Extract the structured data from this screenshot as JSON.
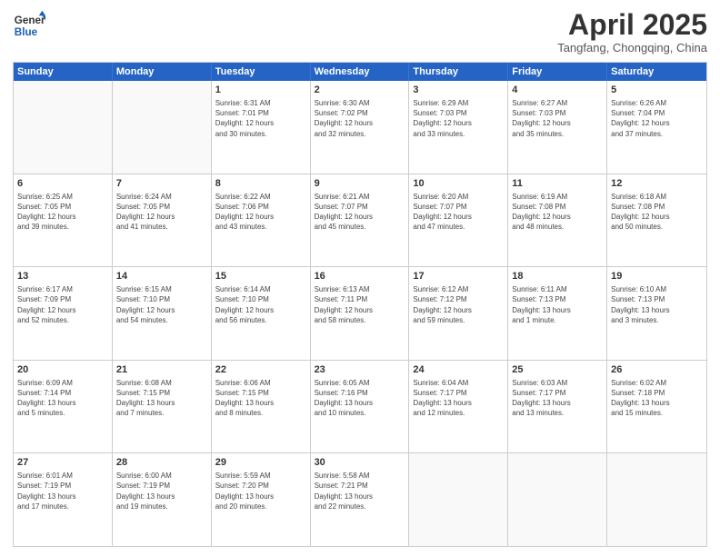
{
  "header": {
    "logo_line1": "General",
    "logo_line2": "Blue",
    "month": "April 2025",
    "location": "Tangfang, Chongqing, China"
  },
  "weekdays": [
    "Sunday",
    "Monday",
    "Tuesday",
    "Wednesday",
    "Thursday",
    "Friday",
    "Saturday"
  ],
  "rows": [
    [
      {
        "day": "",
        "info": ""
      },
      {
        "day": "",
        "info": ""
      },
      {
        "day": "1",
        "info": "Sunrise: 6:31 AM\nSunset: 7:01 PM\nDaylight: 12 hours\nand 30 minutes."
      },
      {
        "day": "2",
        "info": "Sunrise: 6:30 AM\nSunset: 7:02 PM\nDaylight: 12 hours\nand 32 minutes."
      },
      {
        "day": "3",
        "info": "Sunrise: 6:29 AM\nSunset: 7:03 PM\nDaylight: 12 hours\nand 33 minutes."
      },
      {
        "day": "4",
        "info": "Sunrise: 6:27 AM\nSunset: 7:03 PM\nDaylight: 12 hours\nand 35 minutes."
      },
      {
        "day": "5",
        "info": "Sunrise: 6:26 AM\nSunset: 7:04 PM\nDaylight: 12 hours\nand 37 minutes."
      }
    ],
    [
      {
        "day": "6",
        "info": "Sunrise: 6:25 AM\nSunset: 7:05 PM\nDaylight: 12 hours\nand 39 minutes."
      },
      {
        "day": "7",
        "info": "Sunrise: 6:24 AM\nSunset: 7:05 PM\nDaylight: 12 hours\nand 41 minutes."
      },
      {
        "day": "8",
        "info": "Sunrise: 6:22 AM\nSunset: 7:06 PM\nDaylight: 12 hours\nand 43 minutes."
      },
      {
        "day": "9",
        "info": "Sunrise: 6:21 AM\nSunset: 7:07 PM\nDaylight: 12 hours\nand 45 minutes."
      },
      {
        "day": "10",
        "info": "Sunrise: 6:20 AM\nSunset: 7:07 PM\nDaylight: 12 hours\nand 47 minutes."
      },
      {
        "day": "11",
        "info": "Sunrise: 6:19 AM\nSunset: 7:08 PM\nDaylight: 12 hours\nand 48 minutes."
      },
      {
        "day": "12",
        "info": "Sunrise: 6:18 AM\nSunset: 7:08 PM\nDaylight: 12 hours\nand 50 minutes."
      }
    ],
    [
      {
        "day": "13",
        "info": "Sunrise: 6:17 AM\nSunset: 7:09 PM\nDaylight: 12 hours\nand 52 minutes."
      },
      {
        "day": "14",
        "info": "Sunrise: 6:15 AM\nSunset: 7:10 PM\nDaylight: 12 hours\nand 54 minutes."
      },
      {
        "day": "15",
        "info": "Sunrise: 6:14 AM\nSunset: 7:10 PM\nDaylight: 12 hours\nand 56 minutes."
      },
      {
        "day": "16",
        "info": "Sunrise: 6:13 AM\nSunset: 7:11 PM\nDaylight: 12 hours\nand 58 minutes."
      },
      {
        "day": "17",
        "info": "Sunrise: 6:12 AM\nSunset: 7:12 PM\nDaylight: 12 hours\nand 59 minutes."
      },
      {
        "day": "18",
        "info": "Sunrise: 6:11 AM\nSunset: 7:13 PM\nDaylight: 13 hours\nand 1 minute."
      },
      {
        "day": "19",
        "info": "Sunrise: 6:10 AM\nSunset: 7:13 PM\nDaylight: 13 hours\nand 3 minutes."
      }
    ],
    [
      {
        "day": "20",
        "info": "Sunrise: 6:09 AM\nSunset: 7:14 PM\nDaylight: 13 hours\nand 5 minutes."
      },
      {
        "day": "21",
        "info": "Sunrise: 6:08 AM\nSunset: 7:15 PM\nDaylight: 13 hours\nand 7 minutes."
      },
      {
        "day": "22",
        "info": "Sunrise: 6:06 AM\nSunset: 7:15 PM\nDaylight: 13 hours\nand 8 minutes."
      },
      {
        "day": "23",
        "info": "Sunrise: 6:05 AM\nSunset: 7:16 PM\nDaylight: 13 hours\nand 10 minutes."
      },
      {
        "day": "24",
        "info": "Sunrise: 6:04 AM\nSunset: 7:17 PM\nDaylight: 13 hours\nand 12 minutes."
      },
      {
        "day": "25",
        "info": "Sunrise: 6:03 AM\nSunset: 7:17 PM\nDaylight: 13 hours\nand 13 minutes."
      },
      {
        "day": "26",
        "info": "Sunrise: 6:02 AM\nSunset: 7:18 PM\nDaylight: 13 hours\nand 15 minutes."
      }
    ],
    [
      {
        "day": "27",
        "info": "Sunrise: 6:01 AM\nSunset: 7:19 PM\nDaylight: 13 hours\nand 17 minutes."
      },
      {
        "day": "28",
        "info": "Sunrise: 6:00 AM\nSunset: 7:19 PM\nDaylight: 13 hours\nand 19 minutes."
      },
      {
        "day": "29",
        "info": "Sunrise: 5:59 AM\nSunset: 7:20 PM\nDaylight: 13 hours\nand 20 minutes."
      },
      {
        "day": "30",
        "info": "Sunrise: 5:58 AM\nSunset: 7:21 PM\nDaylight: 13 hours\nand 22 minutes."
      },
      {
        "day": "",
        "info": ""
      },
      {
        "day": "",
        "info": ""
      },
      {
        "day": "",
        "info": ""
      }
    ]
  ]
}
